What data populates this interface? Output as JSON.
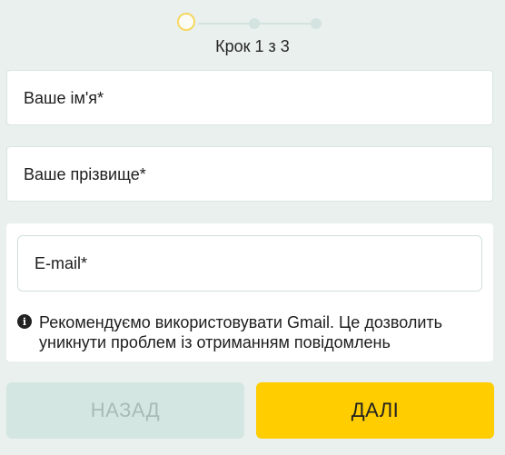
{
  "stepper": {
    "label": "Крок 1 з 3",
    "current": 1,
    "total": 3
  },
  "form": {
    "first_name_placeholder": "Ваше ім'я*",
    "last_name_placeholder": "Ваше прізвище*",
    "email_placeholder": "E-mail*",
    "email_hint": "Рекомендуємо використовувати Gmail. Це дозволить уникнути проблем із отриманням повідомлень"
  },
  "buttons": {
    "back_label": "НАЗАД",
    "next_label": "ДАЛІ"
  },
  "colors": {
    "accent": "#ffcd00",
    "background": "#e9f0ee",
    "back_button": "#d4e6e1"
  },
  "icons": {
    "hint": "info-icon"
  }
}
